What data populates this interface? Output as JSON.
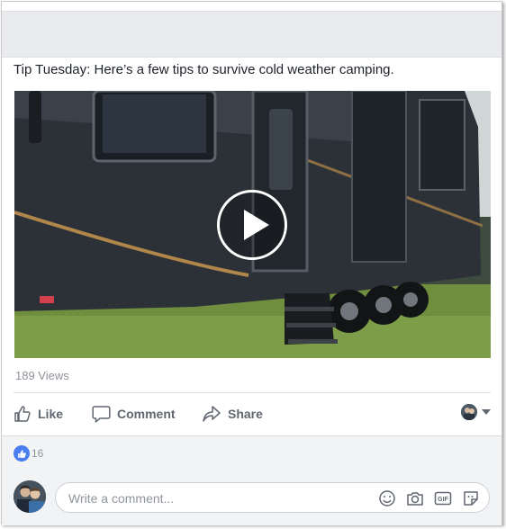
{
  "post": {
    "text": "Tip Tuesday: Here’s a few tips to survive cold weather camping."
  },
  "video": {
    "views_count": "189 Views"
  },
  "actions": {
    "like_label": "Like",
    "comment_label": "Comment",
    "share_label": "Share"
  },
  "reactions": {
    "like_count": "16"
  },
  "composer": {
    "placeholder": "Write a comment..."
  },
  "icons": {
    "like": "thumbs-up-icon",
    "comment": "speech-bubble-icon",
    "share": "share-arrow-icon",
    "emoji": "smiley-icon",
    "camera": "camera-icon",
    "gif": "gif-icon",
    "sticker": "sticker-icon",
    "play": "play-icon"
  },
  "colors": {
    "accent_blue": "#4a7ef0",
    "action_text": "#606770",
    "muted_text": "#90949c"
  }
}
